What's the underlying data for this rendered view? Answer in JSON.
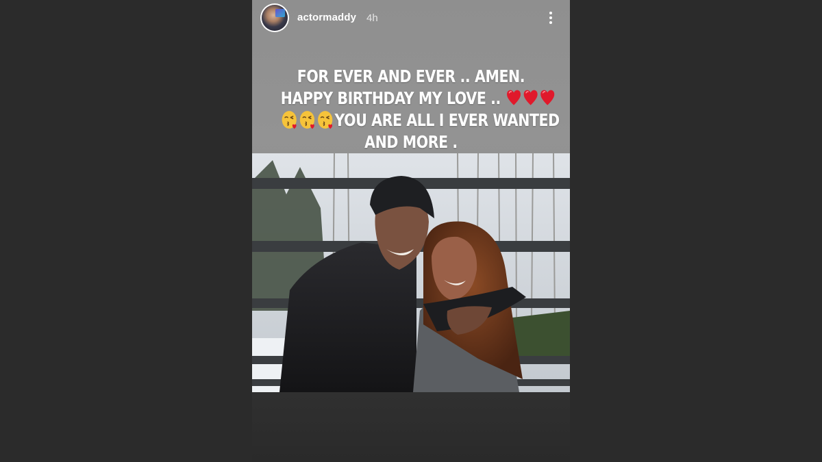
{
  "story": {
    "username": "actormaddy",
    "time": "4h",
    "caption": {
      "line1": "FOR EVER AND EVER .. AMEN.",
      "line2_text": "HAPPY BIRTHDAY MY LOVE ..",
      "line3_text": "YOU ARE ALL I EVER WANTED",
      "line4": "AND MORE ."
    },
    "icons": {
      "avatar": "profile-avatar",
      "menu": "more-vertical-icon",
      "heart": "red-heart-emoji",
      "kiss": "face-blowing-kiss-emoji"
    }
  },
  "colors": {
    "page_background": "#2b2b2b",
    "story_background": "#8f8f8f",
    "text": "#ffffff",
    "heart": "#e0192b"
  }
}
